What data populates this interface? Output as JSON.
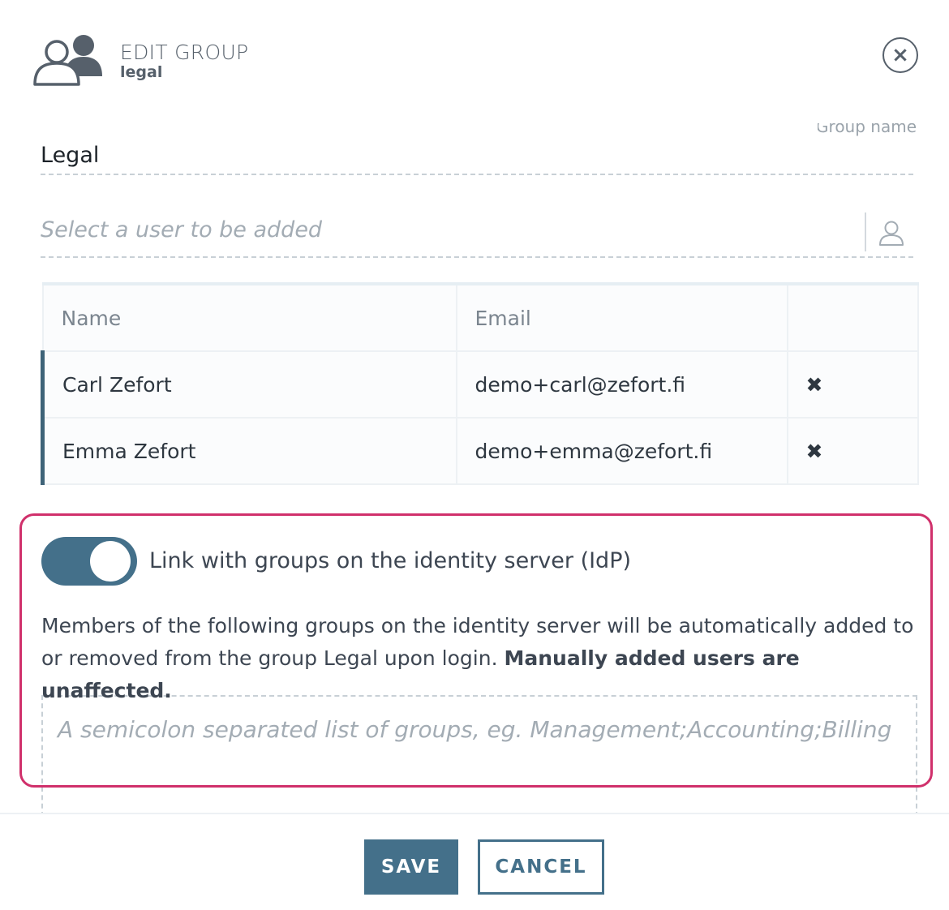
{
  "header": {
    "title": "EDIT GROUP",
    "subtitle": "legal",
    "group_icon": "users-group-icon",
    "close_icon": "close-icon",
    "close_glyph": "×"
  },
  "group_name": {
    "label": "Group name",
    "value": "Legal"
  },
  "user_select": {
    "placeholder": "Select a user to be added",
    "icon": "user-icon"
  },
  "members_table": {
    "columns": [
      "Name",
      "Email",
      ""
    ],
    "rows": [
      {
        "name": "Carl Zefort",
        "email": "demo+carl@zefort.fi",
        "action_icon": "remove-icon",
        "action_glyph": "✖"
      },
      {
        "name": "Emma Zefort",
        "email": "demo+emma@zefort.fi",
        "action_icon": "remove-icon",
        "action_glyph": "✖"
      }
    ]
  },
  "idp_link": {
    "toggle_on": true,
    "toggle_label": "Link with groups on the identity server (IdP)",
    "description": "Members of the following groups on the identity server will be automatically added to or removed from the group Legal upon login.",
    "description_bold": "Manually added users are unaffected.",
    "groups_placeholder": "A semicolon separated list of groups, eg. Management;Accounting;Billing"
  },
  "footer": {
    "save_label": "SAVE",
    "cancel_label": "CANCEL"
  },
  "colors": {
    "accent": "#44708a",
    "highlight_border": "#d0306b",
    "remove": "#b93c63"
  }
}
